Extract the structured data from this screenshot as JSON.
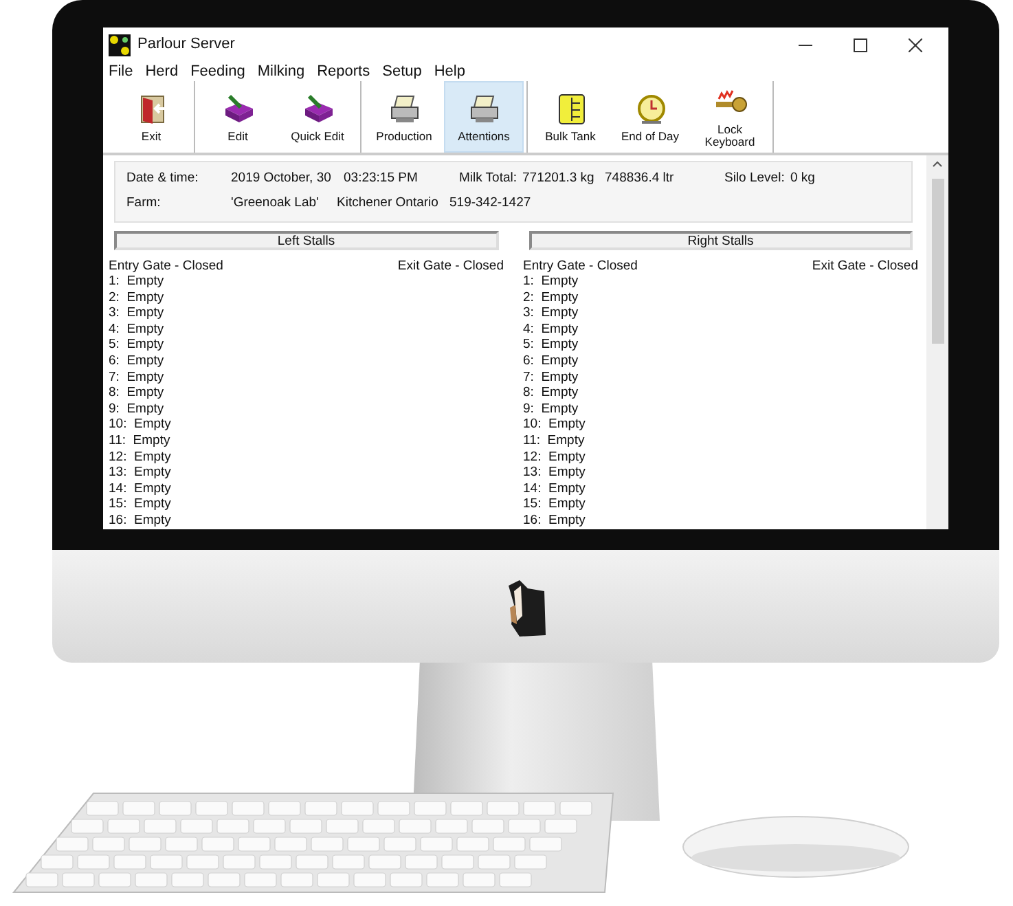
{
  "window": {
    "title": "Parlour Server"
  },
  "menu": [
    "File",
    "Herd",
    "Feeding",
    "Milking",
    "Reports",
    "Setup",
    "Help"
  ],
  "toolbar": [
    {
      "buttons": [
        {
          "label": "Exit",
          "kind": "door",
          "selected": false
        }
      ]
    },
    {
      "buttons": [
        {
          "label": "Edit",
          "kind": "edit",
          "selected": false
        },
        {
          "label": "Quick Edit",
          "kind": "edit",
          "selected": false
        }
      ]
    },
    {
      "buttons": [
        {
          "label": "Production",
          "kind": "printer",
          "selected": false
        },
        {
          "label": "Attentions",
          "kind": "printer",
          "selected": true
        }
      ]
    },
    {
      "buttons": [
        {
          "label": "Bulk Tank",
          "kind": "tank",
          "selected": false
        },
        {
          "label": "End of Day",
          "kind": "clock",
          "selected": false
        },
        {
          "label": "Lock Keyboard",
          "kind": "key",
          "selected": false
        }
      ]
    }
  ],
  "info": {
    "date_label": "Date & time:",
    "date": "2019 October, 30",
    "time": "03:23:15 PM",
    "milk_label": "Milk Total:",
    "milk_kg": "771201.3 kg",
    "milk_ltr": "748836.4 ltr",
    "silo_label": "Silo Level:",
    "silo": "0 kg",
    "farm_label": "Farm:",
    "farm_name": "'Greenoak Lab'",
    "farm_location": "Kitchener Ontario",
    "farm_phone": "519-342-1427"
  },
  "stalls": [
    {
      "title": "Left Stalls",
      "entry_gate": "Entry Gate - Closed",
      "exit_gate": "Exit Gate - Closed",
      "rows": [
        {
          "number": "1:",
          "status": "Empty"
        },
        {
          "number": "2:",
          "status": "Empty"
        },
        {
          "number": "3:",
          "status": "Empty"
        },
        {
          "number": "4:",
          "status": "Empty"
        },
        {
          "number": "5:",
          "status": "Empty"
        },
        {
          "number": "6:",
          "status": "Empty"
        },
        {
          "number": "7:",
          "status": "Empty"
        },
        {
          "number": "8:",
          "status": "Empty"
        },
        {
          "number": "9:",
          "status": "Empty"
        },
        {
          "number": "10:",
          "status": "Empty"
        },
        {
          "number": "11:",
          "status": "Empty"
        },
        {
          "number": "12:",
          "status": "Empty"
        },
        {
          "number": "13:",
          "status": "Empty"
        },
        {
          "number": "14:",
          "status": "Empty"
        },
        {
          "number": "15:",
          "status": "Empty"
        },
        {
          "number": "16:",
          "status": "Empty"
        }
      ]
    },
    {
      "title": "Right Stalls",
      "entry_gate": "Entry Gate - Closed",
      "exit_gate": "Exit Gate - Closed",
      "rows": [
        {
          "number": "1:",
          "status": "Empty"
        },
        {
          "number": "2:",
          "status": "Empty"
        },
        {
          "number": "3:",
          "status": "Empty"
        },
        {
          "number": "4:",
          "status": "Empty"
        },
        {
          "number": "5:",
          "status": "Empty"
        },
        {
          "number": "6:",
          "status": "Empty"
        },
        {
          "number": "7:",
          "status": "Empty"
        },
        {
          "number": "8:",
          "status": "Empty"
        },
        {
          "number": "9:",
          "status": "Empty"
        },
        {
          "number": "10:",
          "status": "Empty"
        },
        {
          "number": "11:",
          "status": "Empty"
        },
        {
          "number": "12:",
          "status": "Empty"
        },
        {
          "number": "13:",
          "status": "Empty"
        },
        {
          "number": "14:",
          "status": "Empty"
        },
        {
          "number": "15:",
          "status": "Empty"
        },
        {
          "number": "16:",
          "status": "Empty"
        }
      ]
    }
  ]
}
